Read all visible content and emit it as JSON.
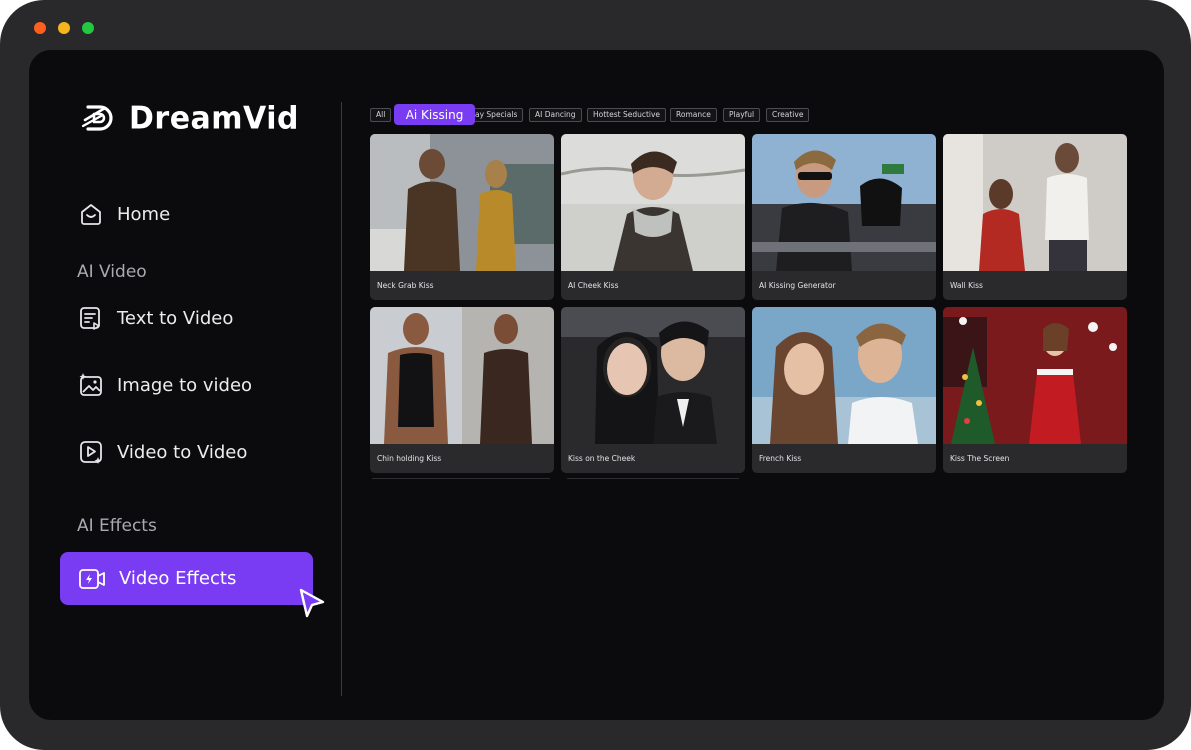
{
  "app": {
    "name": "DreamVid",
    "colors": {
      "accent": "#7a3cf2",
      "window": "#29292c",
      "screen": "#0b0b0d"
    }
  },
  "sidebar": {
    "home": {
      "label": "Home",
      "icon": "home-icon"
    },
    "sections": [
      {
        "label": "AI Video"
      },
      {
        "label": "AI Effects"
      }
    ],
    "items": [
      {
        "label": "Text to Video",
        "icon": "text-video-icon"
      },
      {
        "label": "Image to video",
        "icon": "image-video-icon"
      },
      {
        "label": "Video to Video",
        "icon": "video-video-icon"
      }
    ],
    "active": {
      "label": "Video Effects",
      "icon": "video-effects-icon"
    }
  },
  "tabs": {
    "active": "Ai Kissing",
    "items": [
      "All",
      "ay Specials",
      "AI Dancing",
      "Hottest Seductive",
      "Romance",
      "Playful",
      "Creative"
    ]
  },
  "cards": [
    {
      "title": "Neck Grab Kiss"
    },
    {
      "title": "AI Cheek Kiss"
    },
    {
      "title": "AI Kissing Generator"
    },
    {
      "title": "Wall Kiss"
    },
    {
      "title": "Chin holding Kiss"
    },
    {
      "title": "Kiss on the Cheek"
    },
    {
      "title": "French Kiss"
    },
    {
      "title": "Kiss The Screen"
    }
  ]
}
